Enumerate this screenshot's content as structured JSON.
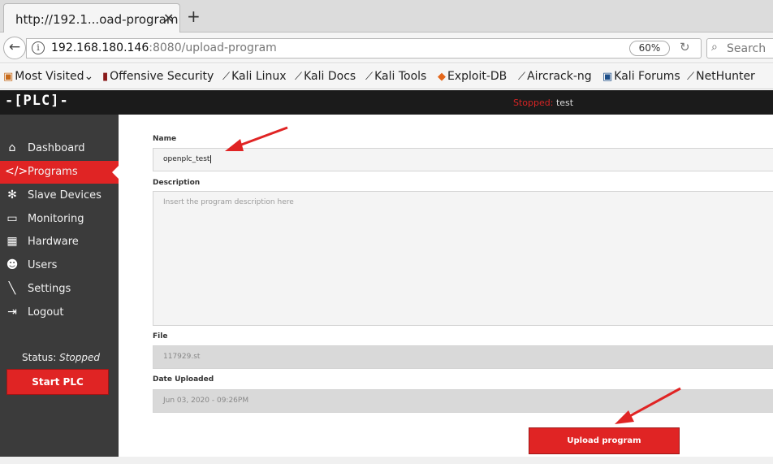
{
  "browser": {
    "tab_title": "http://192.1...oad-program",
    "tab_close": "✕",
    "new_tab": "+",
    "url_host": "192.168.180.146",
    "url_rest": ":8080/upload-program",
    "zoom": "60%",
    "search_placeholder": "Search"
  },
  "bookmarks": [
    {
      "label": "Most Visited",
      "icon": "folder-icon"
    },
    {
      "label": "Offensive Security",
      "icon": "offsec-icon"
    },
    {
      "label": "Kali Linux",
      "icon": "kali-icon"
    },
    {
      "label": "Kali Docs",
      "icon": "kali-icon"
    },
    {
      "label": "Kali Tools",
      "icon": "kali-icon"
    },
    {
      "label": "Exploit-DB",
      "icon": "exploitdb-icon"
    },
    {
      "label": "Aircrack-ng",
      "icon": "aircrack-icon"
    },
    {
      "label": "Kali Forums",
      "icon": "forums-icon"
    },
    {
      "label": "NetHunter",
      "icon": "kali-icon"
    }
  ],
  "header": {
    "logo": "PLC",
    "status_label": "Stopped:",
    "status_program": "test"
  },
  "sidebar": {
    "items": [
      {
        "label": "Dashboard",
        "icon": "home-icon"
      },
      {
        "label": "Programs",
        "icon": "code-icon"
      },
      {
        "label": "Slave Devices",
        "icon": "gear-icon"
      },
      {
        "label": "Monitoring",
        "icon": "monitor-icon"
      },
      {
        "label": "Hardware",
        "icon": "chip-icon"
      },
      {
        "label": "Users",
        "icon": "users-icon"
      },
      {
        "label": "Settings",
        "icon": "wrench-icon"
      },
      {
        "label": "Logout",
        "icon": "logout-icon"
      }
    ],
    "active_index": 1,
    "status_label": "Status:",
    "status_value": "Stopped",
    "start_button": "Start PLC"
  },
  "form": {
    "name_label": "Name",
    "name_value": "openplc_test",
    "description_label": "Description",
    "description_placeholder": "Insert the program description here",
    "file_label": "File",
    "file_value": "117929.st",
    "date_label": "Date Uploaded",
    "date_value": "Jun 03, 2020 - 09:26PM",
    "upload_button": "Upload program"
  },
  "colors": {
    "accent": "#e02424",
    "sidebar_bg": "#3b3b3b",
    "header_bg": "#1b1b1b"
  }
}
